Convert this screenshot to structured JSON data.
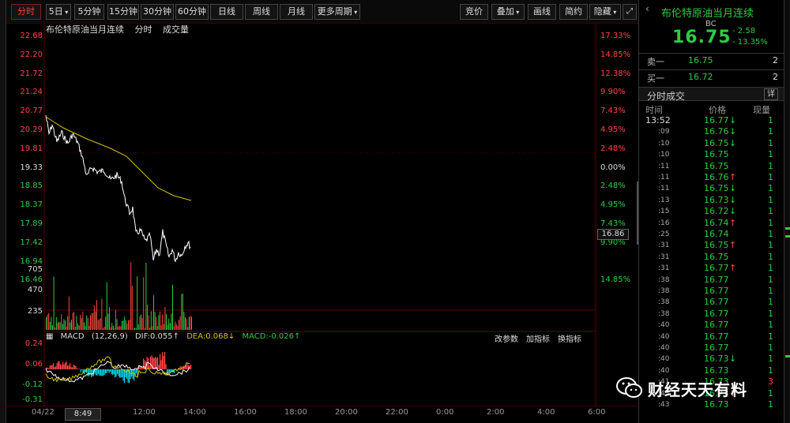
{
  "toolbar": {
    "items": [
      "分时",
      "5日",
      "5分钟",
      "15分钟",
      "30分钟",
      "60分钟",
      "日线",
      "周线",
      "月线",
      "更多周期"
    ],
    "selected": "分时",
    "right": [
      "竞价",
      "叠加",
      "画线",
      "简约",
      "隐藏"
    ],
    "expand_icon": "expand-icon"
  },
  "chart_title": {
    "name": "布伦特原油当月连续",
    "mode": "分时",
    "volume": "成交量"
  },
  "price_axis": {
    "left": [
      "22.68",
      "22.20",
      "21.72",
      "21.24",
      "20.77",
      "20.29",
      "19.81",
      "19.33",
      "18.85",
      "18.37",
      "17.89",
      "17.42",
      "16.94",
      "16.46"
    ],
    "right": [
      "17.33%",
      "14.85%",
      "12.38%",
      "9.90%",
      "7.43%",
      "4.95%",
      "2.48%",
      "0.00%",
      "2.48%",
      "4.95%",
      "7.43%",
      "9.90%",
      "",
      "14.85%"
    ],
    "current_price": "16.86"
  },
  "volume_axis": [
    "705",
    "470",
    "235"
  ],
  "macd": {
    "label": "MACD",
    "params": "(12,26,9)",
    "dif": "DIF:0.055↑",
    "dea": "DEA:0.068↓",
    "macd": "MACD:-0.026↑",
    "buttons": [
      "改参数",
      "加指标",
      "换指标"
    ],
    "axis": [
      "0.24",
      "0.06",
      "-0.12",
      "-0.31"
    ]
  },
  "time_axis": {
    "labels": [
      "04/22",
      "12:00",
      "14:00",
      "16:00",
      "18:00",
      "20:00",
      "22:00",
      "0:00",
      "2:00",
      "4:00",
      "6:00"
    ],
    "cursor": "8:49"
  },
  "quote": {
    "title": "布伦特原油当月连续",
    "code": "BC",
    "price": "16.75",
    "change": "- 2.58",
    "change_pct": "- 13.35%",
    "sell_label": "卖一",
    "sell_price": "16.75",
    "sell_qty": "2",
    "buy_label": "买一",
    "buy_price": "16.72",
    "buy_qty": "2",
    "trades_title": "分时成交",
    "detail_label": "详",
    "cols": [
      "时间",
      "价格",
      "现量"
    ]
  },
  "trades": [
    {
      "t": "13:52",
      "p": "16.77",
      "a": "↓",
      "v": "1"
    },
    {
      "t": ":09",
      "p": "16.76",
      "a": "↓",
      "v": "1"
    },
    {
      "t": ":10",
      "p": "16.75",
      "a": "↓",
      "v": "1"
    },
    {
      "t": ":10",
      "p": "16.75",
      "a": "",
      "v": "1"
    },
    {
      "t": ":11",
      "p": "16.75",
      "a": "",
      "v": "1"
    },
    {
      "t": ":11",
      "p": "16.76",
      "a": "↑",
      "v": "1"
    },
    {
      "t": ":11",
      "p": "16.75",
      "a": "↓",
      "v": "1"
    },
    {
      "t": ":13",
      "p": "16.73",
      "a": "↓",
      "v": "1"
    },
    {
      "t": ":15",
      "p": "16.72",
      "a": "↓",
      "v": "1"
    },
    {
      "t": ":16",
      "p": "16.74",
      "a": "↑",
      "v": "1"
    },
    {
      "t": ":25",
      "p": "16.74",
      "a": "",
      "v": "1"
    },
    {
      "t": ":31",
      "p": "16.75",
      "a": "↑",
      "v": "1"
    },
    {
      "t": ":31",
      "p": "16.75",
      "a": "",
      "v": "1"
    },
    {
      "t": ":31",
      "p": "16.77",
      "a": "↑",
      "v": "1"
    },
    {
      "t": ":38",
      "p": "16.77",
      "a": "",
      "v": "1"
    },
    {
      "t": ":38",
      "p": "16.77",
      "a": "",
      "v": "1"
    },
    {
      "t": ":38",
      "p": "16.77",
      "a": "",
      "v": "1"
    },
    {
      "t": ":38",
      "p": "16.77",
      "a": "",
      "v": "1"
    },
    {
      "t": ":40",
      "p": "16.77",
      "a": "",
      "v": "1"
    },
    {
      "t": ":40",
      "p": "16.77",
      "a": "",
      "v": "1"
    },
    {
      "t": ":40",
      "p": "16.77",
      "a": "",
      "v": "1"
    },
    {
      "t": ":40",
      "p": "16.73",
      "a": "↓",
      "v": "1"
    },
    {
      "t": ":40",
      "p": "16.73",
      "a": "",
      "v": "1"
    },
    {
      "t": ":41",
      "p": "16.73",
      "a": "",
      "v": "3"
    },
    {
      "t": ":43",
      "p": "16.73",
      "a": "↑",
      "v": "1"
    },
    {
      "t": ":43",
      "p": "16.73",
      "a": "",
      "v": "1"
    }
  ],
  "watermark": {
    "text": "财经天天有料"
  },
  "colors": {
    "up": "#ff4444",
    "down": "#2ecc40",
    "price_line": "#ffffff",
    "avg_line": "#d4c200"
  }
}
